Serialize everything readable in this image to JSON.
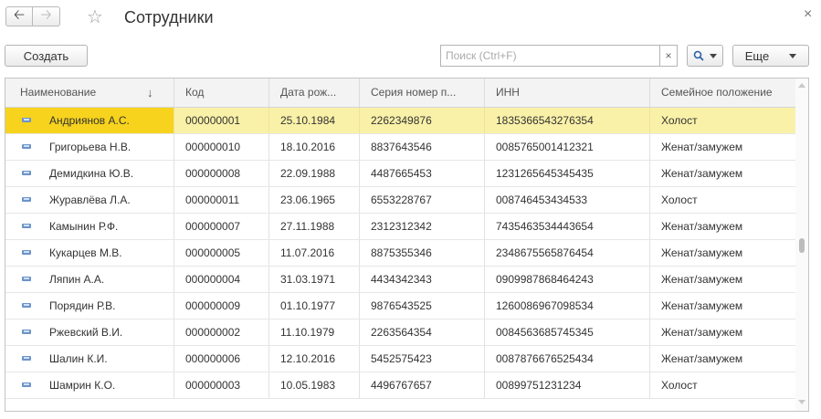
{
  "window": {
    "title": "Сотрудники",
    "close_glyph": "×"
  },
  "toolbar": {
    "create_label": "Создать",
    "search_placeholder": "Поиск (Ctrl+F)",
    "search_value": "",
    "search_clear_glyph": "×",
    "search_icon": "magnifier-icon",
    "more_label": "Еще"
  },
  "table": {
    "columns": [
      "Наименование",
      "Код",
      "Дата рож...",
      "Серия номер п...",
      "ИНН",
      "Семейное положение"
    ],
    "sort_arrow": "↓",
    "selected_row": 0,
    "rows": [
      {
        "name": "Андриянов А.С.",
        "code": "000000001",
        "date": "25.10.1984",
        "passport": "2262349876",
        "inn": "1835366543276354",
        "family": "Холост"
      },
      {
        "name": "Григорьева Н.В.",
        "code": "000000010",
        "date": "18.10.2016",
        "passport": "8837643546",
        "inn": "0085765001412321",
        "family": "Женат/замужем"
      },
      {
        "name": "Демидкина Ю.В.",
        "code": "000000008",
        "date": "22.09.1988",
        "passport": "4487665453",
        "inn": "1231265645345435",
        "family": "Женат/замужем"
      },
      {
        "name": "Журавлёва Л.А.",
        "code": "000000011",
        "date": "23.06.1965",
        "passport": "6553228767",
        "inn": "008746453434533",
        "family": "Холост"
      },
      {
        "name": "Камынин Р.Ф.",
        "code": "000000007",
        "date": "27.11.1988",
        "passport": "2312312342",
        "inn": "7435463534443654",
        "family": "Женат/замужем"
      },
      {
        "name": "Кукарцев М.В.",
        "code": "000000005",
        "date": "11.07.2016",
        "passport": "8875355346",
        "inn": "2348675565876454",
        "family": "Женат/замужем"
      },
      {
        "name": "Ляпин А.А.",
        "code": "000000004",
        "date": "31.03.1971",
        "passport": "4434342343",
        "inn": "0909987868464243",
        "family": "Женат/замужем"
      },
      {
        "name": "Порядин Р.В.",
        "code": "000000009",
        "date": "01.10.1977",
        "passport": "9876543525",
        "inn": "1260086967098534",
        "family": "Женат/замужем"
      },
      {
        "name": "Ржевский В.И.",
        "code": "000000002",
        "date": "11.10.1979",
        "passport": "2263564354",
        "inn": "0084563685745345",
        "family": "Женат/замужем"
      },
      {
        "name": "Шалин К.И.",
        "code": "000000006",
        "date": "12.10.2016",
        "passport": "5452575423",
        "inn": "0087876676525434",
        "family": "Женат/замужем"
      },
      {
        "name": "Шамрин К.О.",
        "code": "000000003",
        "date": "10.05.1983",
        "passport": "4496767657",
        "inn": "00899751231234",
        "family": "Холост"
      }
    ]
  }
}
